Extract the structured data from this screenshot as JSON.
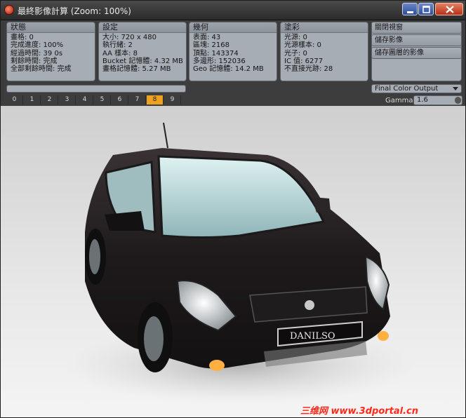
{
  "window": {
    "title": "最終影像計算 (Zoom: 100%)"
  },
  "panels": [
    {
      "title": "狀態",
      "rows": [
        "畫格: 0",
        "完成進度: 100%",
        "經過時間: 39 0s",
        "剩餘時間: 完成",
        "全部剩餘時間: 完成"
      ]
    },
    {
      "title": "設定",
      "rows": [
        "大小: 720 x 480",
        "執行緒: 2",
        "AA 樣本: 8",
        "Bucket 記憶體: 4.32 MB",
        "畫格記憶體: 5.27 MB"
      ]
    },
    {
      "title": "幾何",
      "rows": [
        "表面: 43",
        "區塊: 2168",
        "頂點: 143374",
        "多邊形: 152036",
        "Geo 記憶體: 14.2 MB"
      ]
    },
    {
      "title": "塗彩",
      "rows": [
        "光源: 0",
        "光源樣本: 0",
        "光子: 0",
        "IC 值: 6277",
        "不直接光跡: 28"
      ]
    }
  ],
  "actions": [
    "關閉視窗",
    "儲存影像",
    "儲存圖層的影像"
  ],
  "tabs": [
    "0",
    "1",
    "2",
    "3",
    "4",
    "5",
    "6",
    "7",
    "8",
    "9"
  ],
  "active_tab": "8",
  "output_select": {
    "value": "Final Color Output"
  },
  "gamma": {
    "label": "Gamma",
    "value": "1.6"
  },
  "car": {
    "plate": "DANILSO"
  },
  "watermark": "三维网 www.3dportal.cn",
  "colors": {
    "accent": "#f0a020",
    "panel": "#a7adb5",
    "watermark": "#ff2a1a"
  }
}
